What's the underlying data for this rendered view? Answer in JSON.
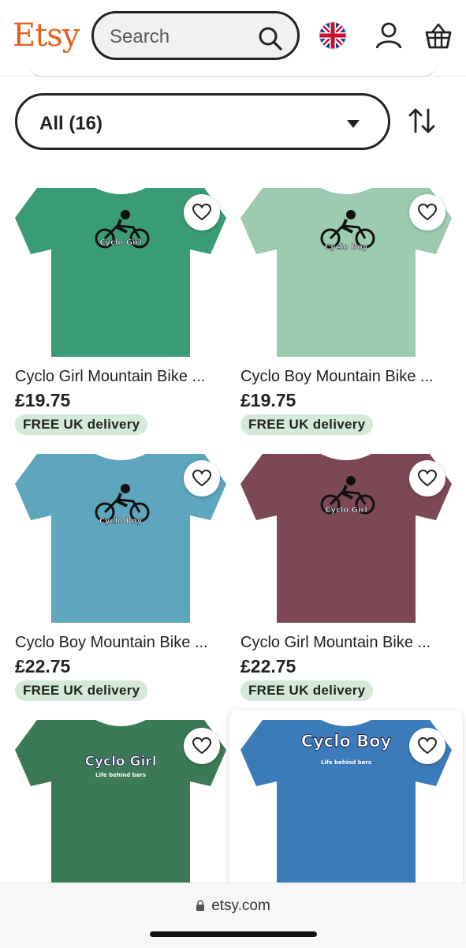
{
  "header": {
    "logo": "Etsy",
    "search_placeholder": "Search",
    "icons": [
      "search-icon",
      "uk-flag-icon",
      "account-icon",
      "basket-icon"
    ]
  },
  "filter": {
    "label": "All (16)",
    "icons": [
      "chevron-down-icon",
      "sort-icon"
    ]
  },
  "products": [
    {
      "title": "Cyclo Girl Mountain Bike ...",
      "price": "£19.75",
      "badge": "FREE UK delivery",
      "shirt_color": "#3a9c76",
      "print_text": "Cyclo Girl"
    },
    {
      "title": "Cyclo Boy Mountain Bike ...",
      "price": "£19.75",
      "badge": "FREE UK delivery",
      "shirt_color": "#9ccbb0",
      "print_text": "Cyclo Boy"
    },
    {
      "title": "Cyclo Boy Mountain Bike ...",
      "price": "£22.75",
      "badge": "FREE UK delivery",
      "shirt_color": "#5ea6bd",
      "print_text": "Cyclo Boy"
    },
    {
      "title": "Cyclo Girl Mountain Bike ...",
      "price": "£22.75",
      "badge": "FREE UK delivery",
      "shirt_color": "#7d4856",
      "print_text": "Cyclo Girl"
    },
    {
      "title": "",
      "price": "",
      "badge": "",
      "shirt_color": "#3c7a57",
      "print_text": "Cyclo Girl",
      "print_subtext": "Life behind bars"
    },
    {
      "title": "",
      "price": "",
      "badge": "",
      "shirt_color": "#3c7bba",
      "print_text": "Cyclo Boy",
      "print_subtext": "Life behind bars"
    }
  ],
  "browser": {
    "url": "etsy.com"
  },
  "colors": {
    "brand": "#e4601e",
    "badge_bg": "#d4e9d7"
  }
}
